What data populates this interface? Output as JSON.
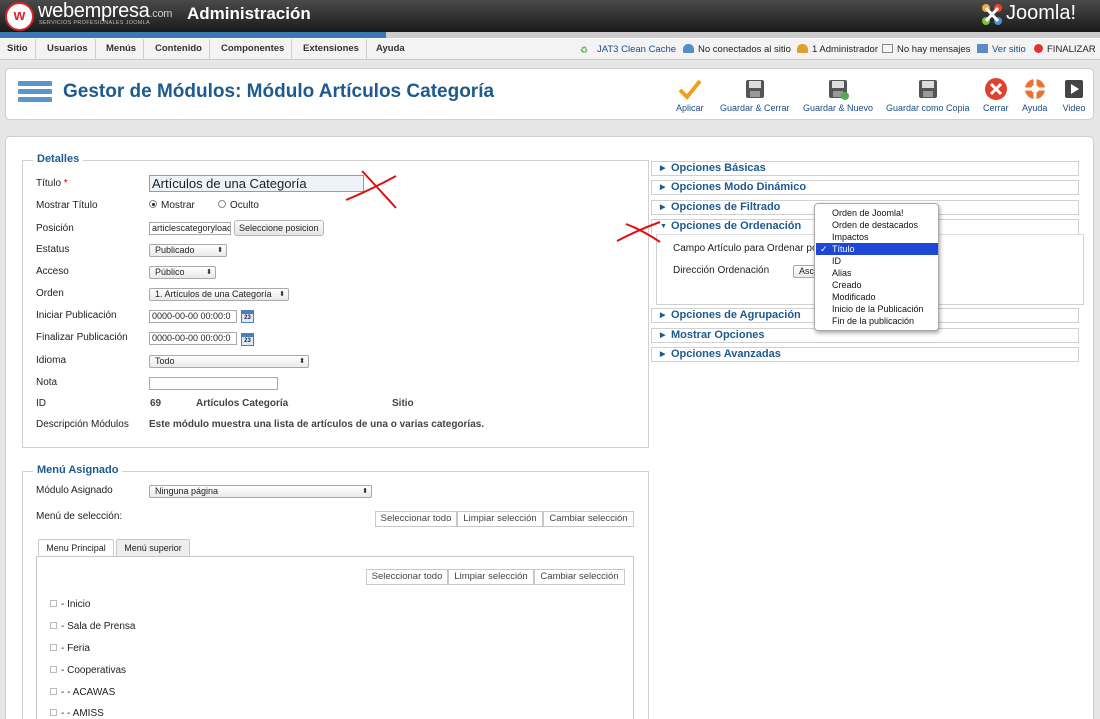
{
  "header": {
    "brand": "webempresa",
    "brand_tld": ".com",
    "brand_tagline": "SERVICIOS PROFESIONALES JOOMLA",
    "admin_title": "Administración",
    "cms_logo": "Joomla!"
  },
  "menu": {
    "items": [
      "Sitio",
      "Usuarios",
      "Menús",
      "Contenido",
      "Componentes",
      "Extensiones",
      "Ayuda"
    ],
    "status": {
      "cache": "JAT3 Clean Cache",
      "site_users": "No conectados al sitio",
      "admins": "1 Administrador",
      "messages": "No hay mensajes",
      "view_site": "Ver sitio",
      "logout": "FINALIZAR"
    }
  },
  "toolbar": {
    "title": "Gestor de Módulos: Módulo Artículos Categoría",
    "buttons": [
      "Aplicar",
      "Guardar & Cerrar",
      "Guardar & Nuevo",
      "Guardar como Copia",
      "Cerrar",
      "Ayuda",
      "Video"
    ]
  },
  "details": {
    "legend": "Detalles",
    "title_label": "Título",
    "title_required": "*",
    "title_value": "Artículos de una Categoría",
    "show_title_label": "Mostrar Título",
    "show_option": "Mostrar",
    "hide_option": "Oculto",
    "position_label": "Posición",
    "position_value": "articlescategoryload",
    "position_button": "Seleccione posicion",
    "status_label": "Estatus",
    "status_value": "Publicado",
    "access_label": "Acceso",
    "access_value": "Público",
    "order_label": "Orden",
    "order_value": "1. Artículos de una Categoría",
    "start_label": "Iniciar Publicación",
    "start_value": "0000-00-00 00:00:0",
    "end_label": "Finalizar Publicación",
    "end_value": "0000-00-00 00:00:0",
    "calendar_text": "23",
    "language_label": "Idioma",
    "language_value": "Todo",
    "note_label": "Nota",
    "note_value": "",
    "id_label": "ID",
    "id_value": "69",
    "module_type": "Artículos Categoría",
    "module_client": "Sitio",
    "description_label": "Descripción Módulos",
    "description_value": "Este módulo muestra una lista de artículos de una o varias categorías."
  },
  "menu_assignment": {
    "legend": "Menú Asignado",
    "assigned_label": "Módulo Asignado",
    "assigned_value": "Ninguna página",
    "selection_label": "Menú de selección:",
    "select_all": "Seleccionar todo",
    "clear_selection": "Limpiar selección",
    "toggle_selection": "Cambiar selección",
    "tabs": [
      "Menu Principal",
      "Menú superior"
    ],
    "items": [
      "- Inicio",
      "- Sala de Prensa",
      "- Feria",
      "- Cooperativas",
      "- - ACAWAS",
      "- - AMISS"
    ]
  },
  "options": {
    "sections": [
      "Opciones Básicas",
      "Opciones Modo Dinámico",
      "Opciones de Filtrado",
      "Opciones de Ordenación",
      "Opciones de Agrupación",
      "Mostrar Opciones",
      "Opciones Avanzadas"
    ],
    "order_field_label": "Campo Artículo para Ordenar por",
    "order_direction_label": "Dirección Ordenación",
    "order_direction_value": "Asc",
    "dropdown": {
      "options": [
        "Orden de Joomla!",
        "Orden de destacados",
        "Impactos",
        "Título",
        "ID",
        "Alias",
        "Creado",
        "Modificado",
        "Inicio de la Publicación",
        "Fin de la publicación"
      ],
      "selected": "Título",
      "check": "✓"
    }
  },
  "colors": {
    "accent": "#1d5a90",
    "header_dark": "#1a1a1a",
    "highlight": "#1f47d6",
    "annotation": "#dd1111"
  }
}
